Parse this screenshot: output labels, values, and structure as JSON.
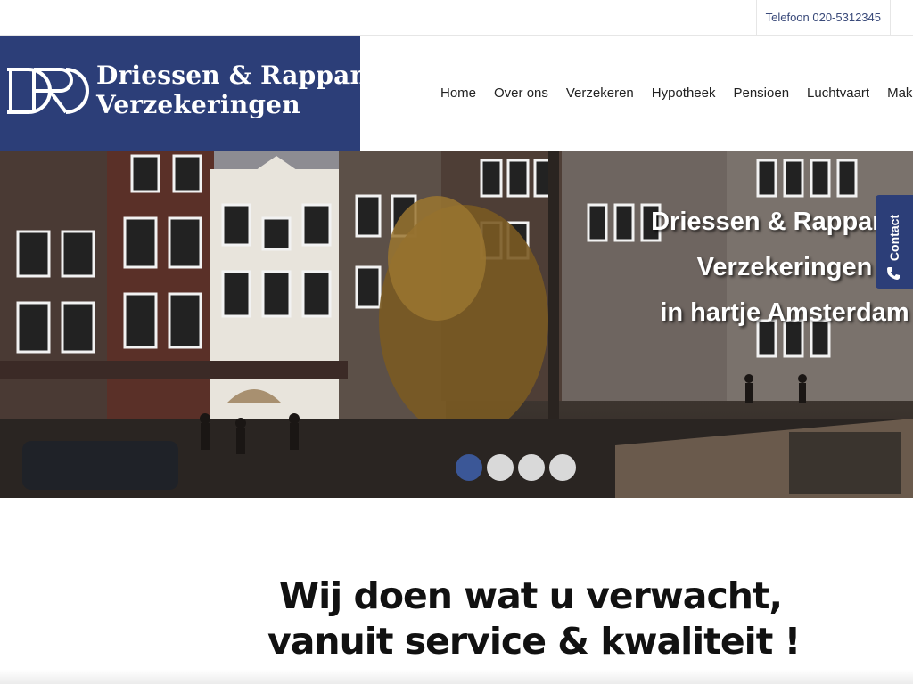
{
  "topbar": {
    "phone": "Telefoon 020-5312345"
  },
  "logo": {
    "mark_letters": "DR",
    "line1": "Driessen & Rappange",
    "line2": "Verzekeringen"
  },
  "nav": {
    "items": [
      {
        "label": "Home"
      },
      {
        "label": "Over ons"
      },
      {
        "label": "Verzekeren"
      },
      {
        "label": "Hypotheek"
      },
      {
        "label": "Pensioen"
      },
      {
        "label": "Luchtvaart"
      },
      {
        "label": "Makelaar"
      }
    ]
  },
  "hero": {
    "line1": "Driessen & Rappange",
    "line2": "Verzekeringen",
    "line3": "in hartje Amsterdam",
    "slides": 4,
    "active_slide": 1
  },
  "contact_tab": {
    "label": "Contact"
  },
  "slogan": {
    "line1": "Wij doen wat u verwacht,",
    "line2": "vanuit service & kwaliteit !"
  },
  "colors": {
    "brand": "#2c3e78",
    "dot_active": "#3b5797",
    "dot_inactive": "#d9d9d9"
  }
}
